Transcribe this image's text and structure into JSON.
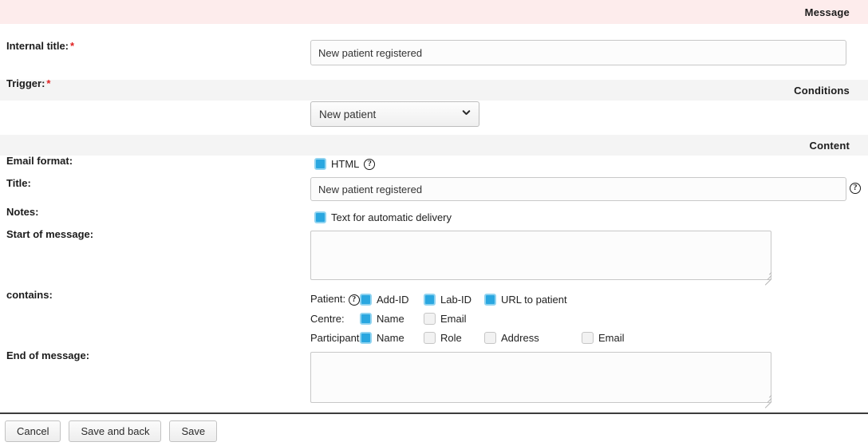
{
  "sections": {
    "message": "Message",
    "conditions": "Conditions",
    "content": "Content"
  },
  "colors": {
    "message_bar_bg": "#fdecec",
    "section_bar_bg": "#f4f4f4",
    "checkbox_checked": "#2aa7e0",
    "required_star": "#e02020"
  },
  "fields": {
    "internal_title": {
      "label": "Internal title:",
      "required_marker": "*",
      "value": "New patient registered",
      "placeholder": ""
    },
    "trigger": {
      "label": "Trigger:",
      "required_marker": "*",
      "selected": "New patient",
      "options": [
        "New patient"
      ]
    },
    "email_format": {
      "label": "Email format:",
      "checkbox_label": "HTML",
      "checked": true,
      "help_icon": "question-mark-icon",
      "help_glyph": "?"
    },
    "title": {
      "label": "Title:",
      "value": "New patient registered",
      "placeholder": "",
      "help_icon": "question-mark-icon",
      "help_glyph": "?"
    },
    "notes": {
      "label": "Notes:",
      "checkbox_label": "Text for automatic delivery",
      "checked": true
    },
    "start_of_message": {
      "label": "Start of message:",
      "value": "",
      "placeholder": ""
    },
    "contains": {
      "label": "contains:",
      "help_glyph": "?",
      "rows": [
        {
          "row_label": "Patient:",
          "has_help": true,
          "items": [
            {
              "label": "Add-ID",
              "checked": true
            },
            {
              "label": "Lab-ID",
              "checked": true
            },
            {
              "label": "URL to patient",
              "checked": true
            }
          ]
        },
        {
          "row_label": "Centre:",
          "has_help": false,
          "items": [
            {
              "label": "Name",
              "checked": true
            },
            {
              "label": "Email",
              "checked": false
            }
          ]
        },
        {
          "row_label": "Participant:",
          "has_help": false,
          "items": [
            {
              "label": "Name",
              "checked": true
            },
            {
              "label": "Role",
              "checked": false
            },
            {
              "label": "Address",
              "checked": false
            },
            {
              "label": "Email",
              "checked": false
            }
          ]
        }
      ]
    },
    "end_of_message": {
      "label": "End of message:",
      "value": "",
      "placeholder": ""
    }
  },
  "buttons": {
    "cancel": "Cancel",
    "save_and_back": "Save and back",
    "save": "Save"
  }
}
